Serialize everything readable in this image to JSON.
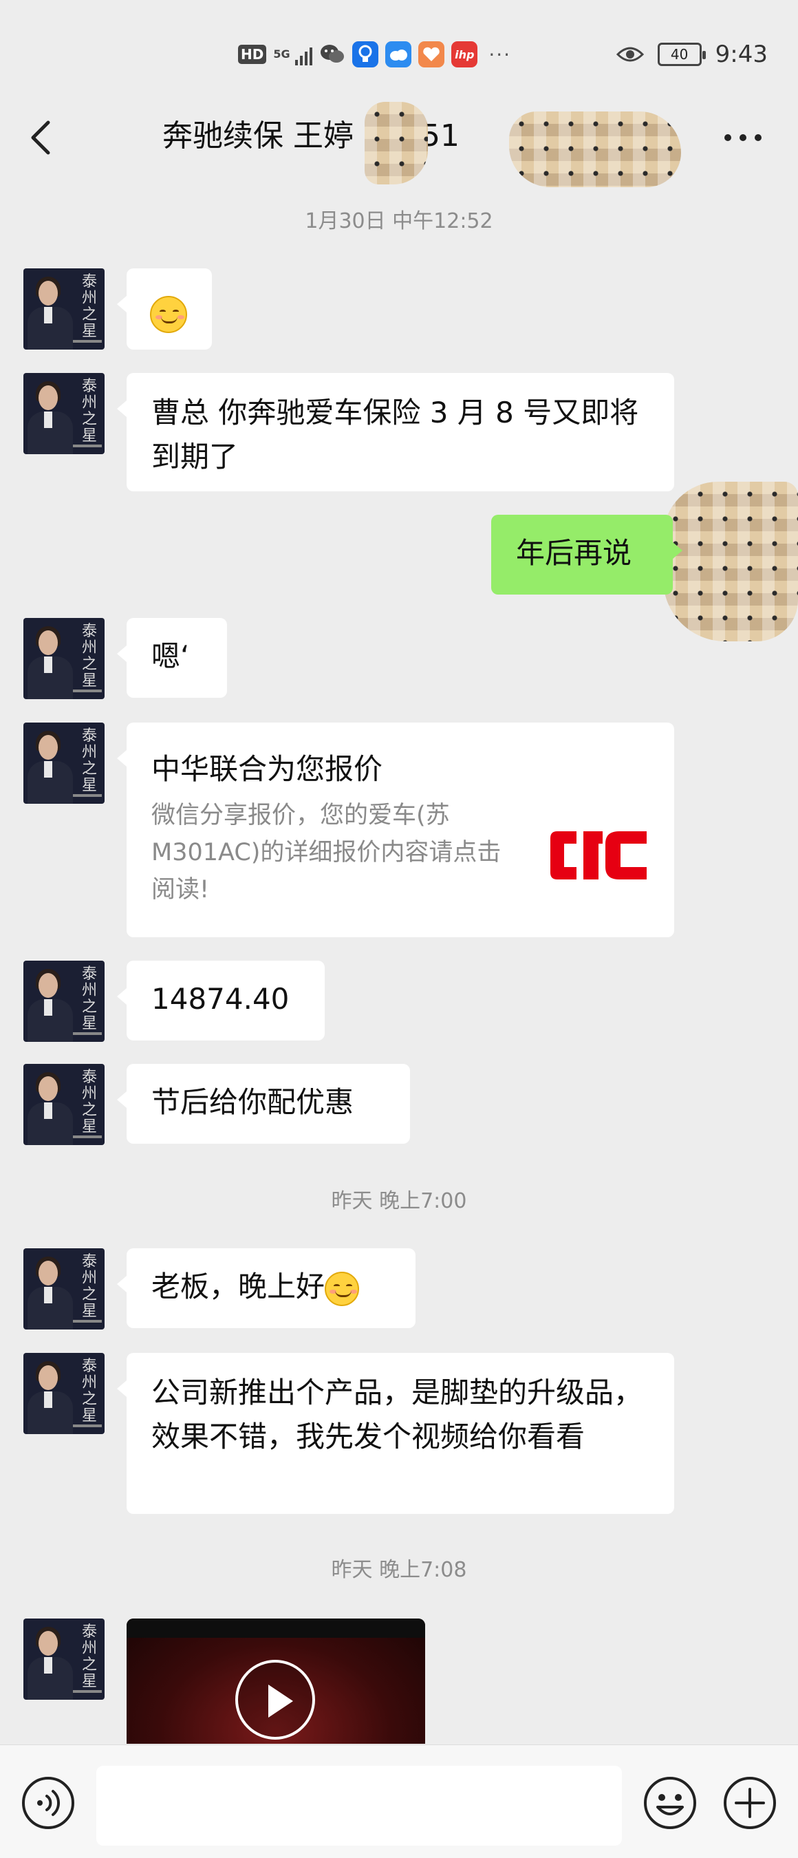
{
  "status_bar": {
    "hd": "HD",
    "network": "5G",
    "app_icons": [
      "bulb-app-icon",
      "weather-app-icon",
      "health-app-icon",
      "ihp-app-icon"
    ],
    "app_badge_text": "ihp",
    "more": "···",
    "battery": "40",
    "time": "9:43"
  },
  "header": {
    "title": "奔驰续保 王婷 15951"
  },
  "messages": {
    "ts1": "1月30日 中午12:52",
    "m1_emoji": "smiling-face",
    "m2": "曹总 你奔驰爱车保险 3 月 8 号又即将到期了",
    "m3_me": "年后再说",
    "m4": "嗯‘",
    "card": {
      "title": "中华联合为您报价",
      "desc": "微信分享报价，您的爱车(苏M301AC)的详细报价内容请点击阅读!",
      "logo_text": "CIC",
      "logo_color": "#e60012"
    },
    "m6": "14874.40",
    "m7": "节后给你配优惠",
    "ts2": "昨天 晚上7:00",
    "m8": "老板，晚上好",
    "m9": "公司新推出个产品，是脚垫的升级品，效果不错，我先发个视频给你看看",
    "ts3": "昨天 晚上7:08"
  },
  "avatar": {
    "brand_text": "泰州之星"
  },
  "colors": {
    "chat_bg": "#ededed",
    "my_bubble": "#95ec69",
    "their_bubble": "#ffffff"
  }
}
